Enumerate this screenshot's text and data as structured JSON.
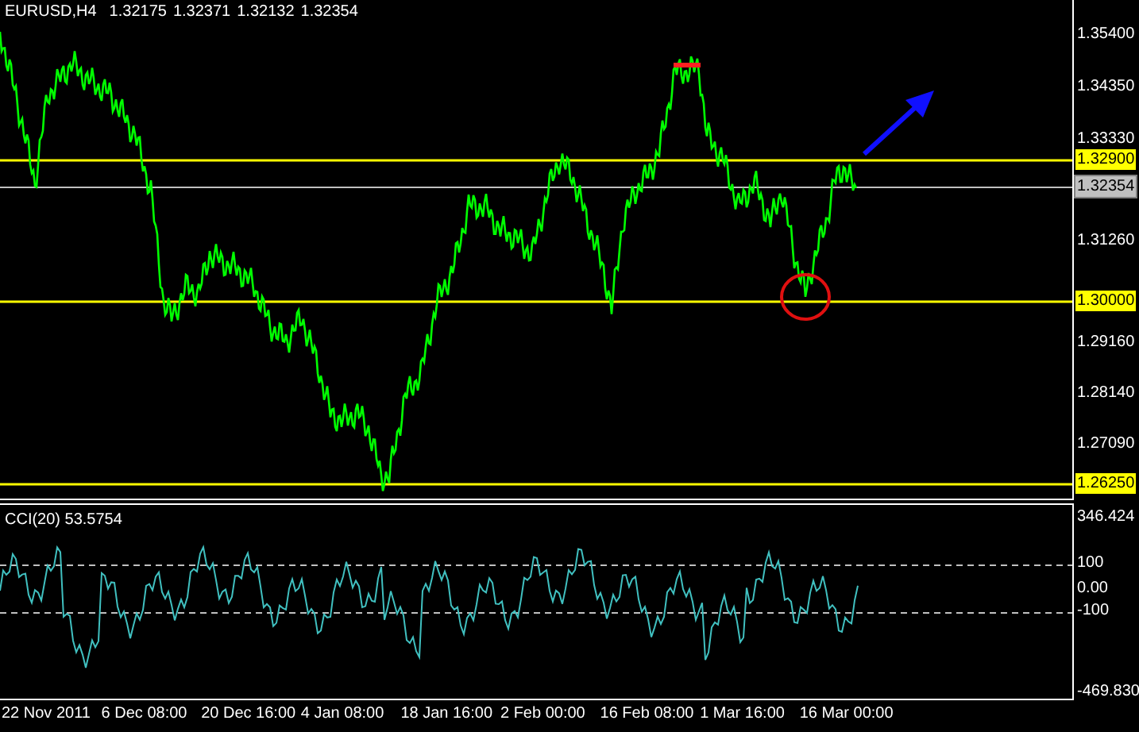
{
  "chart_header": {
    "symbol": "EURUSD,H4",
    "prices": [
      "1.32175",
      "1.32371",
      "1.32132",
      "1.32354"
    ]
  },
  "price_axis": {
    "ticks": [
      "1.35400",
      "1.34350",
      "1.33330",
      "1.31260",
      "1.29160",
      "1.28140",
      "1.27090"
    ]
  },
  "levels": [
    {
      "label": "1.32900",
      "kind": "line",
      "color": "#ffff00"
    },
    {
      "label": "1.32354",
      "kind": "bid",
      "color": "#c0c0c0"
    },
    {
      "label": "1.30000",
      "kind": "line",
      "color": "#ffff00"
    },
    {
      "label": "1.26250",
      "kind": "line",
      "color": "#ffff00"
    }
  ],
  "indicator": {
    "title": "CCI(20) 53.5754",
    "scale": [
      "346.424",
      "100",
      "0.00",
      "-100",
      "-469.830"
    ]
  },
  "time_axis": [
    "22 Nov 2011",
    "6 Dec 08:00",
    "20 Dec 16:00",
    "4 Jan 08:00",
    "18 Jan 16:00",
    "2 Feb 00:00",
    "16 Feb 08:00",
    "1 Mar 16:00",
    "16 Mar 00:00"
  ]
}
